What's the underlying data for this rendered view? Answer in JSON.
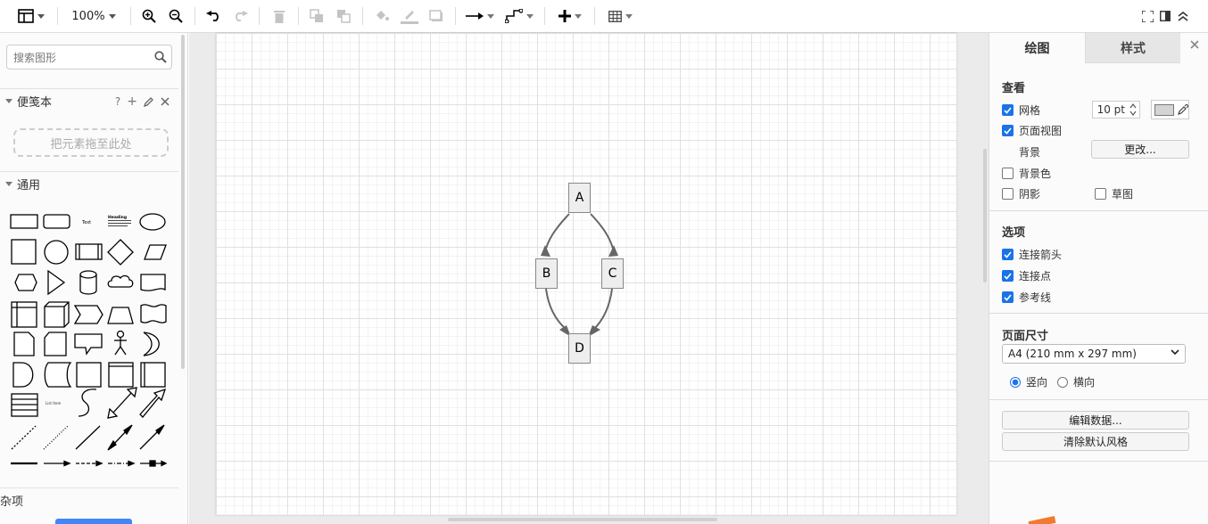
{
  "toolbar": {
    "zoom": "100%"
  },
  "sidebar": {
    "search_placeholder": "搜索图形",
    "scratchpad": {
      "title": "便笺本",
      "help": "?",
      "add": "+",
      "dropzone": "把元素拖至此处"
    },
    "general": {
      "title": "通用"
    },
    "misc": {
      "title": "杂项"
    },
    "shape_text": "Text",
    "shape_heading": "Heading",
    "shape_list_item": "List Item"
  },
  "diagram": {
    "nodes": [
      {
        "id": "A",
        "label": "A"
      },
      {
        "id": "B",
        "label": "B"
      },
      {
        "id": "C",
        "label": "C"
      },
      {
        "id": "D",
        "label": "D"
      }
    ],
    "edges": [
      [
        "A",
        "B"
      ],
      [
        "A",
        "C"
      ],
      [
        "B",
        "D"
      ],
      [
        "C",
        "D"
      ]
    ]
  },
  "panel": {
    "tabs": [
      {
        "label": "绘图",
        "active": true
      },
      {
        "label": "样式",
        "active": false
      }
    ],
    "view": {
      "title": "查看",
      "grid": {
        "label": "网格",
        "checked": true,
        "size": "10 pt"
      },
      "page_view": {
        "label": "页面视图",
        "checked": true
      },
      "background": {
        "label": "背景",
        "button": "更改..."
      },
      "bg_color": {
        "label": "背景色",
        "checked": false
      },
      "shadow": {
        "label": "阴影",
        "checked": false
      },
      "sketch": {
        "label": "草图",
        "checked": false
      }
    },
    "options": {
      "title": "选项",
      "connection_arrows": {
        "label": "连接箭头",
        "checked": true
      },
      "connection_points": {
        "label": "连接点",
        "checked": true
      },
      "guides": {
        "label": "参考线",
        "checked": true
      }
    },
    "page_size": {
      "title": "页面尺寸",
      "selected": "A4 (210 mm x 297 mm)",
      "portrait": {
        "label": "竖向",
        "checked": true
      },
      "landscape": {
        "label": "横向",
        "checked": false
      }
    },
    "edit_data_button": "编辑数据...",
    "clear_style_button": "清除默认风格"
  },
  "colors": {
    "accent": "#1a73e8",
    "node_fill": "#eeeeee",
    "edge": "#666666"
  }
}
